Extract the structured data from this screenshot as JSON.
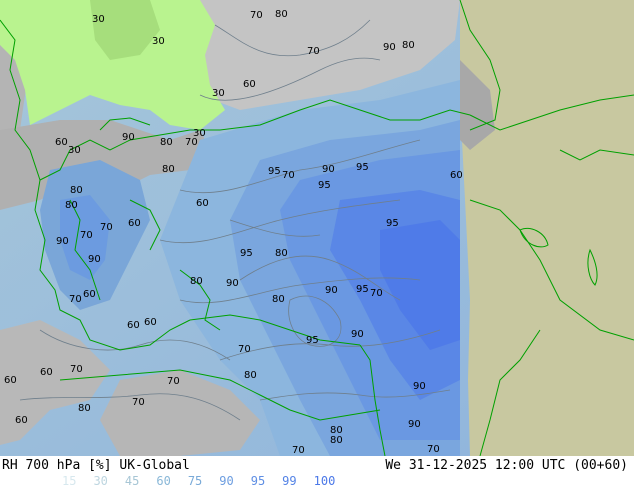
{
  "title_left": "RH 700 hPa [%] UK-Global",
  "title_right": "We 31-12-2025 12:00 UTC (00+60)",
  "legend": [
    {
      "value": "15",
      "color": "#d7e8ee"
    },
    {
      "value": "30",
      "color": "#bed6e0"
    },
    {
      "value": "45",
      "color": "#a7c6d5"
    },
    {
      "value": "60",
      "color": "#8ab8d8"
    },
    {
      "value": "75",
      "color": "#7aaad8"
    },
    {
      "value": "90",
      "color": "#6c9de0"
    },
    {
      "value": "95",
      "color": "#5f8fe4"
    },
    {
      "value": "99",
      "color": "#5483e6"
    },
    {
      "value": "100",
      "color": "#4c79e8"
    }
  ],
  "colors": {
    "land_dry": "#c8c8a0",
    "moist_low": "#b8f08a",
    "gray": "#a0a0a0",
    "coast": "#00a000"
  },
  "contour_labels": [
    "30",
    "30",
    "70",
    "80",
    "30",
    "60",
    "70",
    "90",
    "80",
    "30",
    "60",
    "90",
    "80",
    "70",
    "30",
    "70",
    "80",
    "80",
    "70",
    "95",
    "90",
    "95",
    "60",
    "90",
    "80",
    "95",
    "70",
    "60",
    "95",
    "60",
    "80",
    "90",
    "95",
    "80",
    "90",
    "90",
    "95",
    "70",
    "60",
    "95",
    "70",
    "80",
    "90",
    "60",
    "60",
    "70",
    "80",
    "60",
    "60",
    "70",
    "70",
    "80",
    "90",
    "70",
    "60",
    "80",
    "70",
    "80",
    "90",
    "70"
  ]
}
